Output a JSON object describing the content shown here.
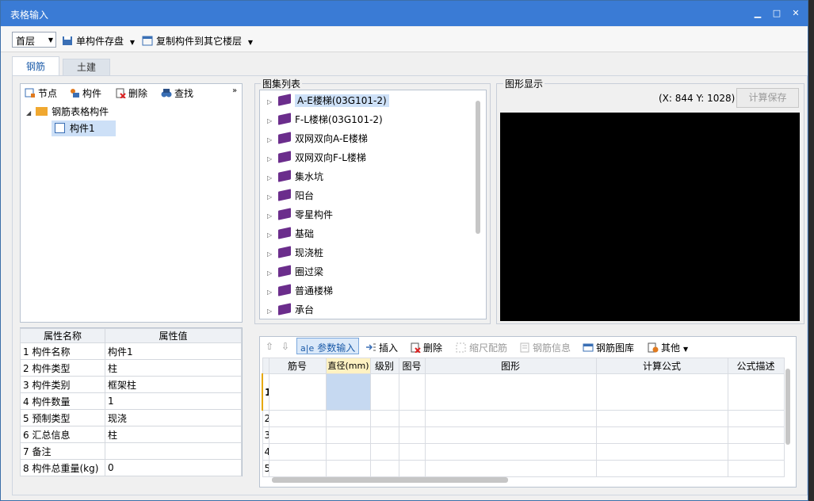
{
  "window": {
    "title": "表格输入",
    "minimize_label": "▁",
    "restore_label": "□",
    "close_label": "✕"
  },
  "toolbar": {
    "floor_value": "首层",
    "save_single_label": "单构件存盘",
    "copy_label": "复制构件到其它楼层"
  },
  "tabs": [
    {
      "label": "钢筋"
    },
    {
      "label": "土建"
    }
  ],
  "left_toolbar": {
    "node": "节点",
    "component": "构件",
    "delete": "删除",
    "find": "查找",
    "more": "»"
  },
  "tree": {
    "root": "钢筋表格构件",
    "child": "构件1"
  },
  "properties": {
    "headers": [
      "属性名称",
      "属性值"
    ],
    "rows": [
      {
        "n": "1",
        "name": "构件名称",
        "value": "构件1"
      },
      {
        "n": "2",
        "name": "构件类型",
        "value": "柱"
      },
      {
        "n": "3",
        "name": "构件类别",
        "value": "框架柱"
      },
      {
        "n": "4",
        "name": "构件数量",
        "value": "1"
      },
      {
        "n": "5",
        "name": "预制类型",
        "value": "现浇"
      },
      {
        "n": "6",
        "name": "汇总信息",
        "value": "柱"
      },
      {
        "n": "7",
        "name": "备注",
        "value": ""
      },
      {
        "n": "8",
        "name": "构件总重量(kg)",
        "value": "0"
      }
    ]
  },
  "atlas": {
    "title": "图集列表",
    "items": [
      "A-E楼梯(03G101-2)",
      "F-L楼梯(03G101-2)",
      "双网双向A-E楼梯",
      "双网双向F-L楼梯",
      "集水坑",
      "阳台",
      "零星构件",
      "基础",
      "现浇桩",
      "圈过梁",
      "普通楼梯",
      "承台"
    ]
  },
  "graphic": {
    "title": "图形显示",
    "coords": "(X: 844 Y: 1028)",
    "calc_save": "计算保存"
  },
  "bottom_toolbar": {
    "param_input": "参数输入",
    "insert": "插入",
    "delete": "删除",
    "scale": "缩尺配筋",
    "rebar_info": "钢筋信息",
    "rebar_lib": "钢筋图库",
    "other": "其他"
  },
  "grid": {
    "headers": [
      "筋号",
      "直径(mm)",
      "级别",
      "图号",
      "图形",
      "计算公式",
      "公式描述"
    ],
    "rows": [
      "1",
      "2",
      "3",
      "4",
      "5"
    ]
  },
  "colors": {
    "title_bar": "#3a7bd5",
    "canvas": "#000000",
    "selection": "#cde0f7",
    "book_icon": "#6b2d8c"
  }
}
